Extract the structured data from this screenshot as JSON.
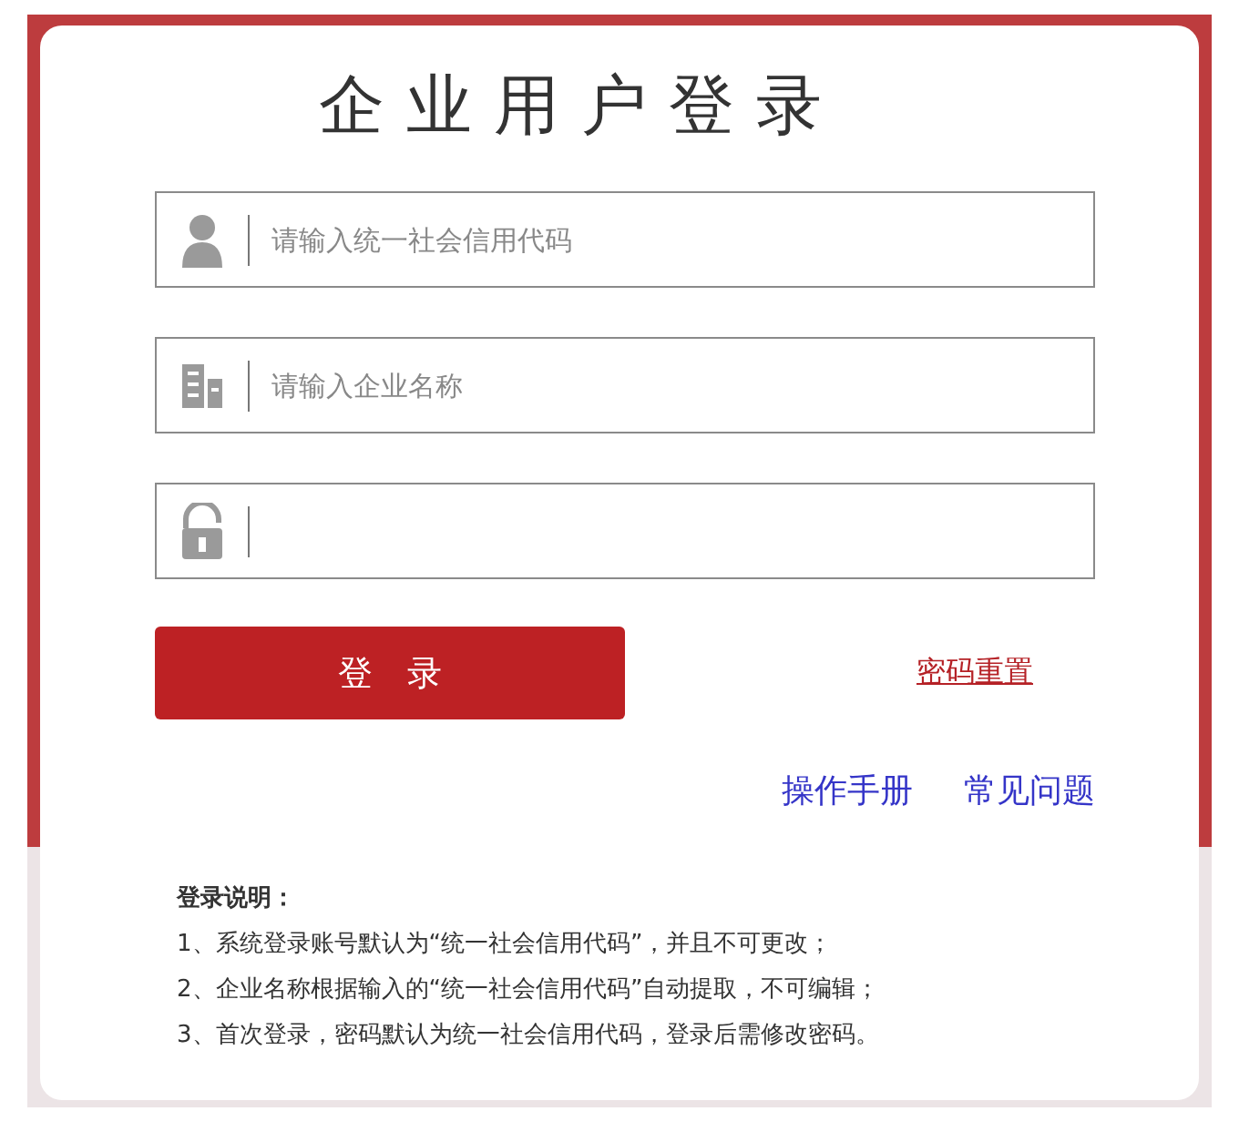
{
  "title": "企业用户登录",
  "fields": [
    {
      "kind": "user",
      "placeholder": "请输入统一社会信用代码"
    },
    {
      "kind": "building",
      "placeholder": "请输入企业名称"
    },
    {
      "kind": "lock"
    }
  ],
  "login_button": "登　录",
  "reset_link": "密码重置",
  "links": [
    "操作手册",
    "常见问题"
  ],
  "notes": {
    "title": "登录说明：",
    "items": [
      "1、系统登录账号默认为“统一社会信用代码”，并且不可更改；",
      "2、企业名称根据输入的“统一社会信用代码”自动提取，不可编辑；",
      "3、首次登录，密码默认为统一社会信用代码，登录后需修改密码。"
    ]
  }
}
